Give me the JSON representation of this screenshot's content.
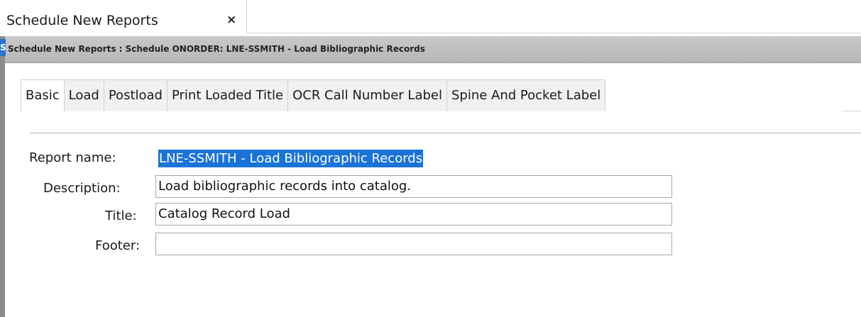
{
  "outer_tab": {
    "label": "Schedule New Reports",
    "close_glyph": "×"
  },
  "window": {
    "icon_glyph": "S",
    "title": "Schedule New Reports : Schedule ONORDER: LNE-SSMITH - Load Bibliographic Records"
  },
  "tabs": [
    {
      "label": "Basic",
      "active": true
    },
    {
      "label": "Load",
      "active": false
    },
    {
      "label": "Postload",
      "active": false
    },
    {
      "label": "Print Loaded Title",
      "active": false
    },
    {
      "label": "OCR Call Number Label",
      "active": false
    },
    {
      "label": "Spine And Pocket Label",
      "active": false
    }
  ],
  "form": {
    "report_name": {
      "label": "Report name:",
      "value": "LNE-SSMITH - Load Bibliographic Records",
      "selected": true
    },
    "description": {
      "label": "Description:",
      "value": "Load bibliographic records into catalog."
    },
    "title": {
      "label": "Title:",
      "value": "Catalog Record Load"
    },
    "footer": {
      "label": "Footer:",
      "value": ""
    }
  },
  "colors": {
    "selection": "#1a73d6",
    "title_bar": "#c0c0c0",
    "frame_strip": "#8c8c8c"
  }
}
